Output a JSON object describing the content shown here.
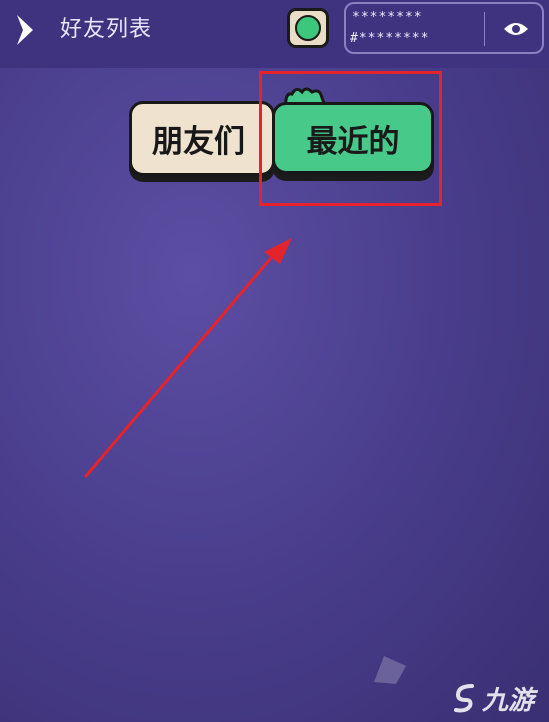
{
  "header": {
    "title": "好友列表",
    "back_icon": "chevron-right-icon",
    "status_color": "#3cc77d",
    "id_box": {
      "password": "********",
      "code": "#********",
      "eye_icon": "eye-icon"
    }
  },
  "tabs": [
    {
      "label": "朋友们",
      "color": "#efe2ce",
      "selected": false
    },
    {
      "label": "最近的",
      "color": "#47c98a",
      "selected": true
    }
  ],
  "annotation": {
    "color": "#e5232b"
  },
  "watermark": {
    "text": "九游"
  }
}
